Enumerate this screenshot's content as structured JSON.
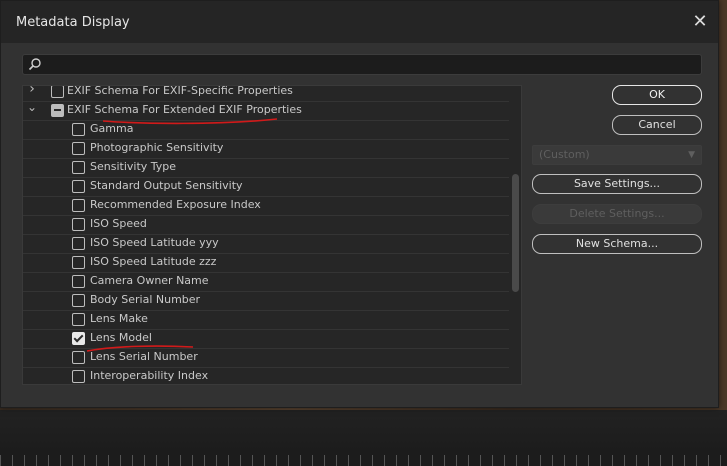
{
  "dialog": {
    "title": "Metadata Display",
    "close_glyph": "✕"
  },
  "search": {
    "value": "",
    "placeholder": ""
  },
  "tree": {
    "rows": [
      {
        "label": "EXIF Schema For EXIF-Specific Properties",
        "type": "group",
        "expanded": false,
        "state": "unchecked"
      },
      {
        "label": "EXIF Schema For Extended EXIF Properties",
        "type": "group",
        "expanded": true,
        "state": "partial"
      },
      {
        "label": "Gamma",
        "type": "item",
        "state": "unchecked"
      },
      {
        "label": "Photographic Sensitivity",
        "type": "item",
        "state": "unchecked"
      },
      {
        "label": "Sensitivity Type",
        "type": "item",
        "state": "unchecked"
      },
      {
        "label": "Standard Output Sensitivity",
        "type": "item",
        "state": "unchecked"
      },
      {
        "label": "Recommended Exposure Index",
        "type": "item",
        "state": "unchecked"
      },
      {
        "label": "ISO Speed",
        "type": "item",
        "state": "unchecked"
      },
      {
        "label": "ISO Speed Latitude yyy",
        "type": "item",
        "state": "unchecked"
      },
      {
        "label": "ISO Speed Latitude zzz",
        "type": "item",
        "state": "unchecked"
      },
      {
        "label": "Camera Owner Name",
        "type": "item",
        "state": "unchecked"
      },
      {
        "label": "Body Serial Number",
        "type": "item",
        "state": "unchecked"
      },
      {
        "label": "Lens Make",
        "type": "item",
        "state": "unchecked"
      },
      {
        "label": "Lens Model",
        "type": "item",
        "state": "checked"
      },
      {
        "label": "Lens Serial Number",
        "type": "item",
        "state": "unchecked"
      },
      {
        "label": "Interoperability Index",
        "type": "item",
        "state": "unchecked"
      }
    ]
  },
  "buttons": {
    "ok": "OK",
    "cancel": "Cancel",
    "save_settings": "Save Settings...",
    "delete_settings": "Delete Settings...",
    "new_schema": "New Schema..."
  },
  "preset": {
    "selected": "(Custom)"
  },
  "colors": {
    "annotation": "#d11a1a",
    "dialog_bg": "#323232",
    "tree_bg": "#262626"
  }
}
